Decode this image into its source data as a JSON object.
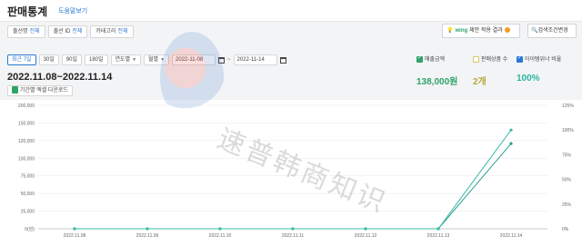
{
  "header": {
    "title": "판매통계",
    "help_label": "도움말보기"
  },
  "filters": [
    {
      "label": "출선명",
      "value": "전체"
    },
    {
      "label": "출선 ID",
      "value": "전체"
    },
    {
      "label": "카테고리",
      "value": "전체"
    }
  ],
  "wing": {
    "brand": "wing",
    "text": "제안 적용 결과"
  },
  "search_condition": {
    "label": "검색조건변경"
  },
  "periods": {
    "items": [
      "최근 7일",
      "30일",
      "90일",
      "180일"
    ],
    "active_index": 0
  },
  "unit_select": {
    "value": "연도별"
  },
  "month_select": {
    "value": "월별"
  },
  "date_start": "2022-11-08",
  "date_end": "2022-11-14",
  "date_sep": "~",
  "range_label": "2022.11.08~2022.11.14",
  "download_label": "기간별 엑셀 다운로드",
  "metrics": [
    {
      "label": "매출금액",
      "value": "138,000원",
      "checked": true,
      "color": "#2fa36b"
    },
    {
      "label": "판매상품 수",
      "value": "2개",
      "checked": false,
      "color": "#b5a83a"
    },
    {
      "label": "아이템위너 비율",
      "value": "100%",
      "checked": true,
      "color": "#2bb5a0"
    }
  ],
  "watermark_text": "速普韩商知识",
  "chart_data": {
    "type": "line",
    "x": [
      "2022.11.08",
      "2022.11.09",
      "2022.11.10",
      "2022.11.11",
      "2022.11.12",
      "2022.11.13",
      "2022.11.14"
    ],
    "series": [
      {
        "name": "매출금액",
        "axis": "left",
        "color": "#2f9c8d",
        "values": [
          0,
          0,
          0,
          0,
          0,
          0,
          138000
        ]
      },
      {
        "name": "아이템위너 비율",
        "axis": "right",
        "color": "#3cb9a5",
        "values": [
          0,
          0,
          0,
          0,
          0,
          0,
          100
        ]
      }
    ],
    "y_left_ticks": [
      "0(원)",
      "25,000",
      "50,000",
      "75,000",
      "100,000",
      "120,000",
      "150,000",
      "200,000"
    ],
    "y_right_ticks": [
      "0%",
      "25%",
      "50%",
      "75%",
      "100%",
      "125%"
    ],
    "ylim_left": [
      0,
      200000
    ],
    "ylim_right": [
      0,
      125
    ],
    "grid": true
  }
}
